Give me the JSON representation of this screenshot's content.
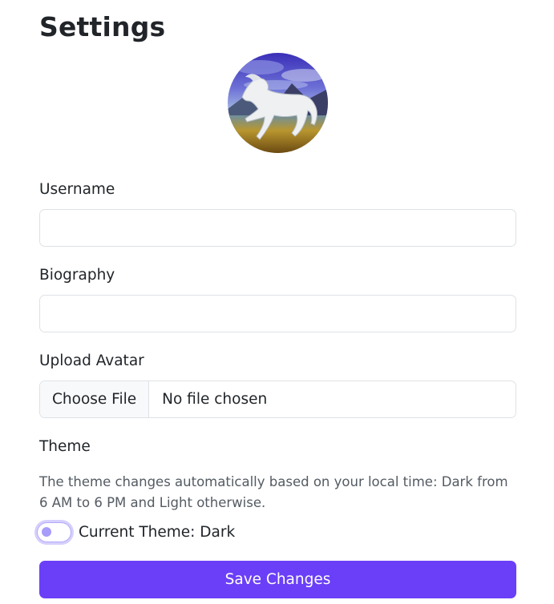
{
  "page": {
    "title": "Settings"
  },
  "avatar": {
    "image": "white-horse-painting"
  },
  "username": {
    "label": "Username",
    "value": "",
    "placeholder": ""
  },
  "biography": {
    "label": "Biography",
    "value": "",
    "placeholder": ""
  },
  "upload_avatar": {
    "label": "Upload Avatar",
    "button_label": "Choose File",
    "status": "No file chosen"
  },
  "theme": {
    "heading": "Theme",
    "help_text": "The theme changes automatically based on your local time: Dark from 6 AM to 6 PM and Light otherwise.",
    "toggle_label": "Current Theme: Dark",
    "toggle_on": false
  },
  "actions": {
    "save_label": "Save Changes"
  },
  "colors": {
    "primary": "#6b3ff8",
    "toggle_accent": "#a79cf9",
    "border": "#dee2e6",
    "muted_text": "#545b62"
  }
}
